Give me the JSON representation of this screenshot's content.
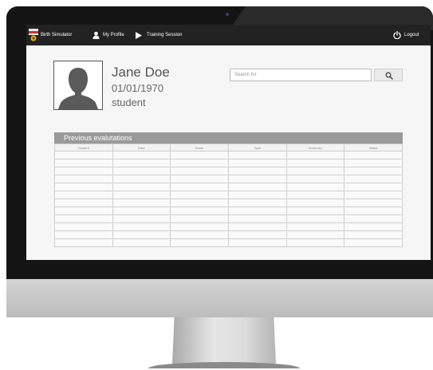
{
  "nav": {
    "items": [
      {
        "label": "Birth Simulator",
        "icon": "app-logo"
      },
      {
        "label": "My Profile",
        "icon": "user-icon"
      },
      {
        "label": "Training Session",
        "icon": "play-icon"
      }
    ],
    "logout_label": "Logout",
    "logout_icon": "power-icon"
  },
  "profile": {
    "name": "Jane Doe",
    "dob": "01/01/1970",
    "role": "student",
    "avatar_icon": "avatar-silhouette-icon"
  },
  "search": {
    "placeholder": "Search for",
    "button_icon": "search-icon"
  },
  "evaluations": {
    "title": "Previous evalutations",
    "columns": [
      "Student",
      "Date",
      "Score",
      "Type",
      "Summary",
      "Notes"
    ],
    "row_count": 12
  },
  "colors": {
    "bezel": "#141414",
    "nav_bg": "#222222",
    "section_header": "#9a9a9a"
  }
}
